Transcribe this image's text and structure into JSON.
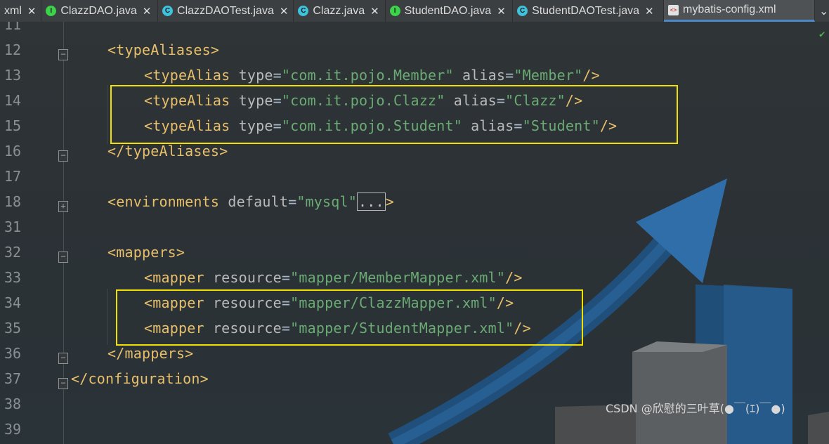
{
  "tabs": [
    {
      "name": ".xml",
      "label": "xml",
      "icon": "none",
      "active": false
    },
    {
      "label": "ClazzDAO.java",
      "icon": "interface-icon",
      "icon_glyph": "I",
      "active": false
    },
    {
      "label": "ClazzDAOTest.java",
      "icon": "class-icon",
      "icon_glyph": "C",
      "active": false
    },
    {
      "label": "Clazz.java",
      "icon": "class-icon",
      "icon_glyph": "C",
      "active": false
    },
    {
      "label": "StudentDAO.java",
      "icon": "interface-icon",
      "icon_glyph": "I",
      "active": false
    },
    {
      "label": "StudentDAOTest.java",
      "icon": "class-icon",
      "icon_glyph": "C",
      "active": false
    },
    {
      "label": "mybatis-config.xml",
      "icon": "xml-file-icon",
      "icon_glyph": "<>",
      "active": true
    }
  ],
  "close_glyph": "✕",
  "overflow_glyph": "⌄",
  "check_glyph": "✔",
  "lines": [
    {
      "num": "11",
      "fold": "",
      "code": []
    },
    {
      "num": "12",
      "fold": "−",
      "code": [
        [
          "t",
          "<typeAliases>"
        ]
      ]
    },
    {
      "num": "13",
      "fold": "",
      "code": [
        [
          "t",
          "<typeAlias "
        ],
        [
          "a",
          "type"
        ],
        [
          "eq",
          "="
        ],
        [
          "v",
          "\"com.it.pojo.Member\""
        ],
        [
          "a",
          " alias"
        ],
        [
          "eq",
          "="
        ],
        [
          "v",
          "\"Member\""
        ],
        [
          "t",
          "/>"
        ]
      ]
    },
    {
      "num": "14",
      "fold": "",
      "code": [
        [
          "t",
          "<typeAlias "
        ],
        [
          "a",
          "type"
        ],
        [
          "eq",
          "="
        ],
        [
          "v",
          "\"com.it.pojo.Clazz\""
        ],
        [
          "a",
          " alias"
        ],
        [
          "eq",
          "="
        ],
        [
          "v",
          "\"Clazz\""
        ],
        [
          "t",
          "/>"
        ]
      ]
    },
    {
      "num": "15",
      "fold": "",
      "code": [
        [
          "t",
          "<typeAlias "
        ],
        [
          "a",
          "type"
        ],
        [
          "eq",
          "="
        ],
        [
          "v",
          "\"com.it.pojo.Student\""
        ],
        [
          "a",
          " alias"
        ],
        [
          "eq",
          "="
        ],
        [
          "v",
          "\"Student\""
        ],
        [
          "t",
          "/>"
        ]
      ]
    },
    {
      "num": "16",
      "fold": "−",
      "code": [
        [
          "t",
          "</typeAliases>"
        ]
      ]
    },
    {
      "num": "17",
      "fold": "",
      "code": []
    },
    {
      "num": "18",
      "fold": "+",
      "code": [
        [
          "t",
          "<environments "
        ],
        [
          "a",
          "default"
        ],
        [
          "eq",
          "="
        ],
        [
          "v",
          "\"mysql\""
        ],
        [
          "collapsed",
          "..."
        ],
        [
          "t",
          ">"
        ]
      ]
    },
    {
      "num": "31",
      "fold": "",
      "code": []
    },
    {
      "num": "32",
      "fold": "−",
      "code": [
        [
          "t",
          "<mappers>"
        ]
      ]
    },
    {
      "num": "33",
      "fold": "",
      "code": [
        [
          "t",
          "<mapper "
        ],
        [
          "a",
          "resource"
        ],
        [
          "eq",
          "="
        ],
        [
          "v",
          "\"mapper/MemberMapper.xml\""
        ],
        [
          "t",
          "/>"
        ]
      ]
    },
    {
      "num": "34",
      "fold": "",
      "code": [
        [
          "t",
          "<mapper "
        ],
        [
          "a",
          "resource"
        ],
        [
          "eq",
          "="
        ],
        [
          "v",
          "\"mapper/ClazzMapper.xml\""
        ],
        [
          "t",
          "/>"
        ]
      ]
    },
    {
      "num": "35",
      "fold": "",
      "code": [
        [
          "t",
          "<mapper "
        ],
        [
          "a",
          "resource"
        ],
        [
          "eq",
          "="
        ],
        [
          "v",
          "\"mapper/StudentMapper.xml\""
        ],
        [
          "t",
          "/>"
        ]
      ]
    },
    {
      "num": "36",
      "fold": "−",
      "code": [
        [
          "t",
          "</mappers>"
        ]
      ]
    },
    {
      "num": "37",
      "fold": "−",
      "code": [
        [
          "t",
          "</configuration>"
        ]
      ]
    },
    {
      "num": "38",
      "fold": "",
      "code": []
    },
    {
      "num": "39",
      "fold": "",
      "code": []
    }
  ],
  "indent_levels": [
    0,
    1,
    2,
    2,
    2,
    1,
    0,
    1,
    0,
    1,
    2,
    2,
    2,
    1,
    0,
    0,
    0
  ],
  "watermark": "CSDN @欣慰的三叶草(●￣(ｴ)￣●)"
}
